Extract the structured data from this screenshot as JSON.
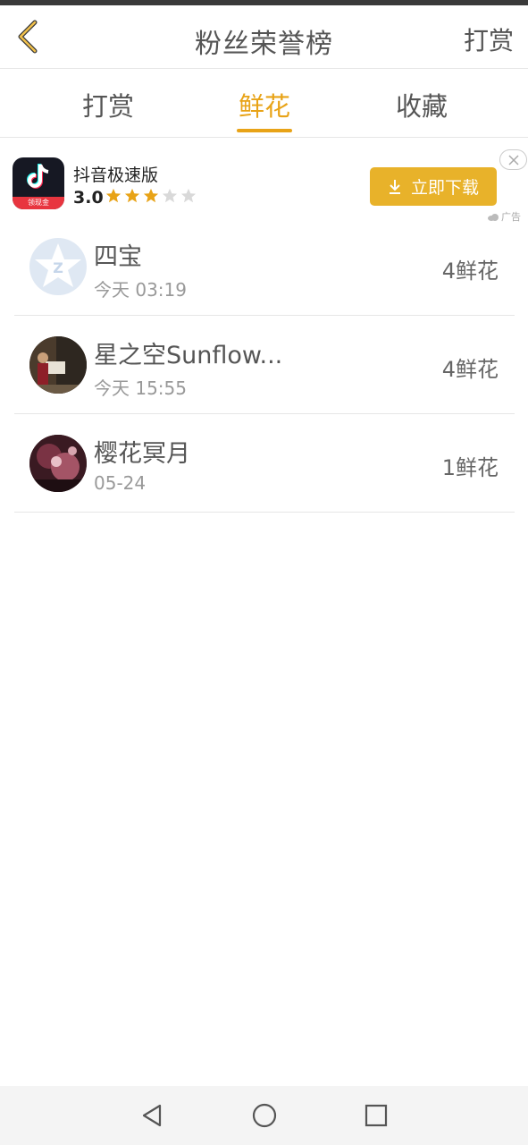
{
  "header": {
    "title": "粉丝荣誉榜",
    "action_label": "打赏"
  },
  "tabs": [
    {
      "label": "打赏",
      "active": false
    },
    {
      "label": "鲜花",
      "active": true
    },
    {
      "label": "收藏",
      "active": false
    }
  ],
  "ad": {
    "app_name": "抖音极速版",
    "rating": "3.0",
    "stars_filled": 3,
    "stars_total": 5,
    "logo_tag": "领现金",
    "download_label": "立即下载",
    "ad_label": "广告"
  },
  "list": [
    {
      "name": "四宝",
      "time": "今天 03:19",
      "count": "4鲜花"
    },
    {
      "name": "星之空Sunflow...",
      "time": "今天 15:55",
      "count": "4鲜花"
    },
    {
      "name": "樱花冥月",
      "time": "05-24",
      "count": "1鲜花"
    }
  ],
  "colors": {
    "accent": "#e8a317",
    "download_button": "#e8b22a"
  },
  "icons": {
    "back": "chevron-left-icon",
    "download": "download-icon",
    "close": "close-icon",
    "nav_back": "triangle-back-icon",
    "nav_home": "circle-home-icon",
    "nav_recent": "square-recent-icon"
  }
}
